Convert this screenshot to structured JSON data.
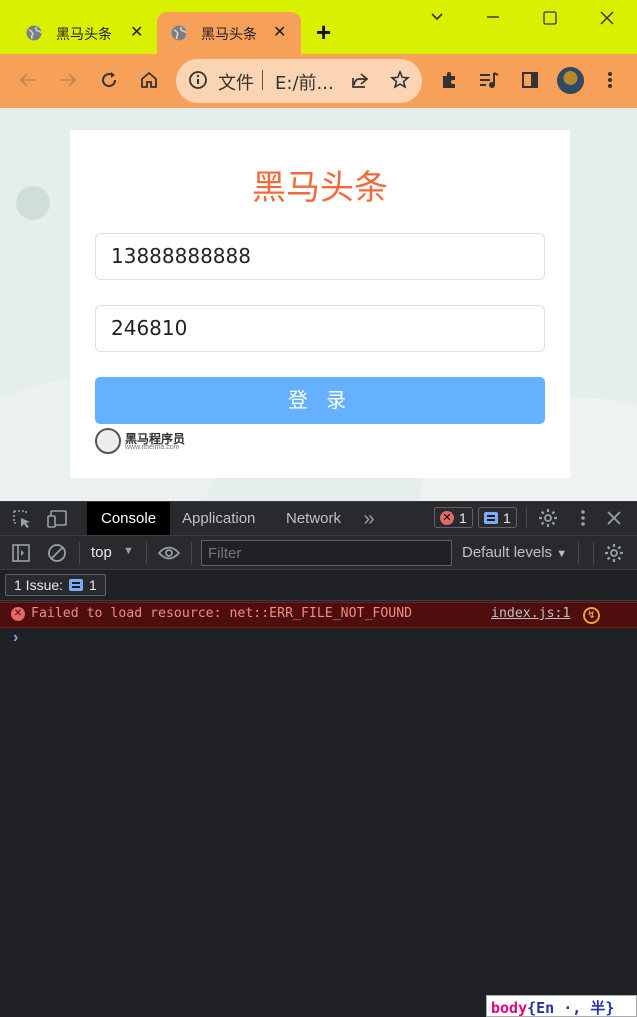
{
  "browser": {
    "tabs": [
      {
        "title": "黑马头条",
        "active": false
      },
      {
        "title": "黑马头条",
        "active": true
      }
    ],
    "new_tab": "+",
    "window_controls": {
      "minimize": "⌄",
      "restore": "▢",
      "close": "✕"
    },
    "address": {
      "scheme_label": "文件",
      "url": "E:/前..."
    },
    "icons": [
      "back-icon",
      "forward-icon",
      "reload-icon",
      "home-icon",
      "info-icon",
      "share-icon",
      "star-icon",
      "extensions-icon",
      "media-icon",
      "sidepanel-icon",
      "avatar",
      "menu-icon"
    ],
    "colors": {
      "tab_strip": "#d9f100",
      "toolbar": "#f7a05a"
    }
  },
  "page": {
    "title": "黑马头条",
    "mobile_value": "13888888888",
    "code_value": "246810",
    "login_label": "登 录",
    "logo_text": "黑马程序员",
    "logo_sub": "www.itheima.com",
    "colors": {
      "title": "#f26a3c",
      "button": "#66b1ff"
    }
  },
  "devtools": {
    "tabs": [
      "Console",
      "Application",
      "Network"
    ],
    "active_tab": "Console",
    "more_tabs": "»",
    "error_count": "1",
    "message_count": "1",
    "context": "top",
    "filter_placeholder": "Filter",
    "levels_label": "Default levels",
    "issues_label": "1 Issue:",
    "issues_count": "1",
    "error_message": "Failed to load resource: net::ERR_FILE_NOT_FOUND",
    "error_source": "index.js:1",
    "prompt": "›"
  },
  "ime": {
    "prefix": "body",
    "mode": "En",
    "sep": "·,",
    "width": "半"
  }
}
